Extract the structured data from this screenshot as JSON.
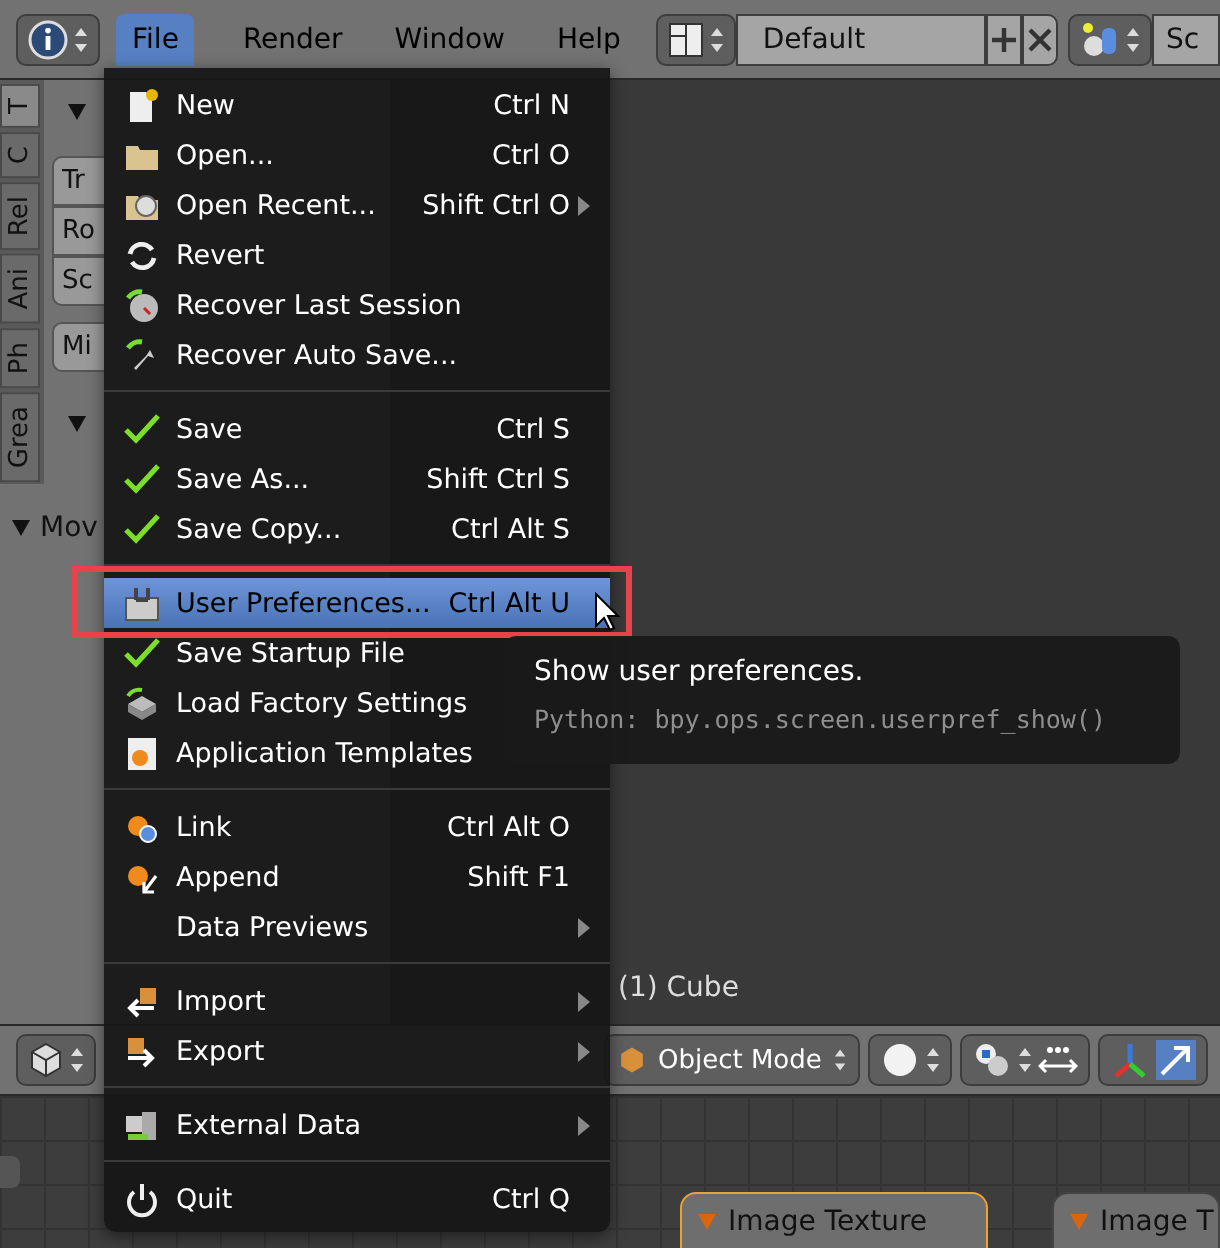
{
  "top_bar": {
    "menus": [
      {
        "label": "File",
        "selected": true
      },
      {
        "label": "Render",
        "selected": false
      },
      {
        "label": "Window",
        "selected": false
      },
      {
        "label": "Help",
        "selected": false
      }
    ],
    "layout": "Default",
    "scene": "Sc"
  },
  "tool_shelf": {
    "tabs": [
      {
        "label": "T",
        "selected": true
      },
      {
        "label": "C",
        "selected": false
      },
      {
        "label": "Rel",
        "selected": false
      },
      {
        "label": "Ani",
        "selected": false
      },
      {
        "label": "Ph",
        "selected": false
      },
      {
        "label": "Grea",
        "selected": false
      }
    ],
    "buttons": [
      "Tr",
      "Ro",
      "Sc"
    ],
    "extra_button": "Mi",
    "panel_title": "Mov"
  },
  "viewport": {
    "object_label": "(1) Cube"
  },
  "viewport_header": {
    "mode": "Object Mode",
    "manipulator_on": true
  },
  "node_editor": {
    "nodes": [
      {
        "title": "Image Texture",
        "selected": true
      },
      {
        "title": "Image T",
        "selected": false
      }
    ]
  },
  "file_menu": {
    "sections": [
      {
        "items": [
          {
            "label": "New",
            "shortcut": "Ctrl N",
            "submenu": false,
            "selected": false
          },
          {
            "label": "Open...",
            "shortcut": "Ctrl O",
            "submenu": false,
            "selected": false
          },
          {
            "label": "Open Recent...",
            "shortcut": "Shift Ctrl O",
            "submenu": true,
            "selected": false
          },
          {
            "label": "Revert",
            "submenu": false,
            "selected": false
          },
          {
            "label": "Recover Last Session",
            "submenu": false,
            "selected": false
          },
          {
            "label": "Recover Auto Save...",
            "submenu": false,
            "selected": false
          }
        ]
      },
      {
        "items": [
          {
            "label": "Save",
            "shortcut": "Ctrl S",
            "submenu": false,
            "selected": false
          },
          {
            "label": "Save As...",
            "shortcut": "Shift Ctrl S",
            "submenu": false,
            "selected": false
          },
          {
            "label": "Save Copy...",
            "shortcut": "Ctrl Alt S",
            "submenu": false,
            "selected": false
          }
        ]
      },
      {
        "items": [
          {
            "label": "User Preferences...",
            "shortcut": "Ctrl Alt U",
            "submenu": false,
            "selected": true
          },
          {
            "label": "Save Startup File",
            "submenu": false,
            "selected": false
          },
          {
            "label": "Load Factory Settings",
            "submenu": false,
            "selected": false
          },
          {
            "label": "Application Templates",
            "submenu": false,
            "selected": false
          }
        ]
      },
      {
        "items": [
          {
            "label": "Link",
            "shortcut": "Ctrl Alt O",
            "submenu": false,
            "selected": false
          },
          {
            "label": "Append",
            "shortcut": "Shift F1",
            "submenu": false,
            "selected": false
          },
          {
            "label": "Data Previews",
            "submenu": true,
            "selected": false
          }
        ]
      },
      {
        "items": [
          {
            "label": "Import",
            "submenu": true,
            "selected": false
          },
          {
            "label": "Export",
            "submenu": true,
            "selected": false
          }
        ]
      },
      {
        "items": [
          {
            "label": "External Data",
            "submenu": true,
            "selected": false
          }
        ]
      },
      {
        "items": [
          {
            "label": "Quit",
            "shortcut": "Ctrl Q",
            "submenu": false,
            "selected": false
          }
        ]
      }
    ]
  },
  "tooltip": {
    "title": "Show user preferences.",
    "python": "Python: bpy.ops.screen.userpref_show()"
  }
}
